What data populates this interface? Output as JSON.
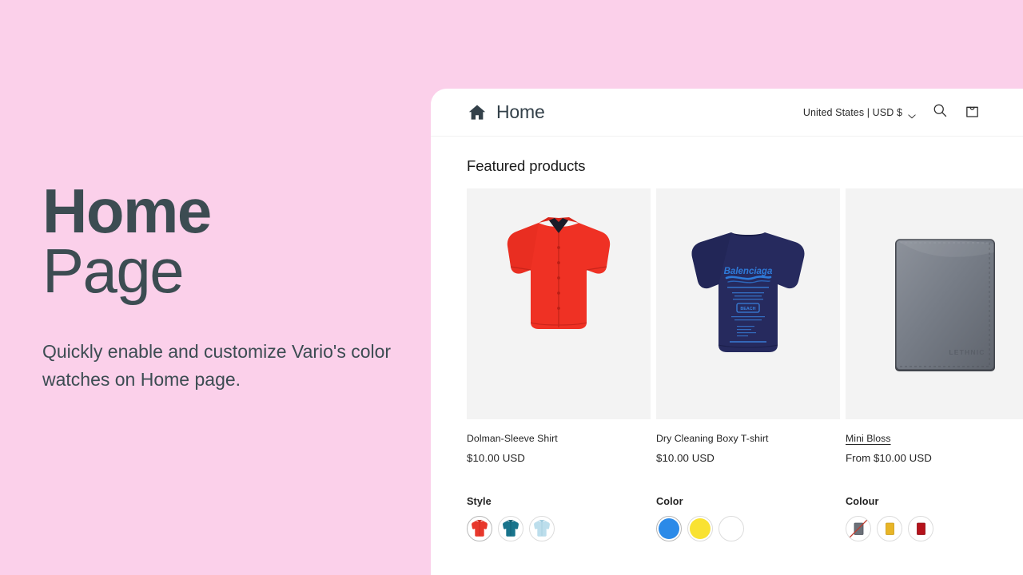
{
  "hero": {
    "title_line1": "Home",
    "title_line2": "Page",
    "subtitle": "Quickly enable and customize Vario's color watches on Home page.",
    "bg_color": "#fbd0ea",
    "text_color": "#3c4c52"
  },
  "header": {
    "home_icon": "home-icon",
    "brand_name": "Home",
    "locale": "United States | USD $",
    "locale_chevron": "chevron-down-icon",
    "search_icon": "search-icon",
    "cart_icon": "cart-icon"
  },
  "main": {
    "section_title": "Featured products",
    "products": [
      {
        "image": "red-dolman-sleeve-shirt",
        "title": "Dolman-Sleeve Shirt",
        "price": "$10.00 USD",
        "is_link": false,
        "option_label": "Style",
        "swatches": [
          {
            "name": "red-shirt-swatch",
            "type": "image",
            "color": "#e8382c",
            "selected": true,
            "unavailable": false
          },
          {
            "name": "teal-shirt-swatch",
            "type": "image",
            "color": "#19748c",
            "selected": false,
            "unavailable": false
          },
          {
            "name": "light-blue-shirt-swatch",
            "type": "image",
            "color": "#bcdeec",
            "selected": false,
            "unavailable": false
          }
        ]
      },
      {
        "image": "navy-dry-cleaning-boxy-tshirt",
        "title": "Dry Cleaning Boxy T-shirt",
        "price": "$10.00 USD",
        "is_link": false,
        "option_label": "Color",
        "swatches": [
          {
            "name": "blue-color-swatch",
            "type": "solid",
            "color": "#2b8ae8",
            "selected": true,
            "unavailable": false
          },
          {
            "name": "yellow-color-swatch",
            "type": "solid",
            "color": "#f9e232",
            "selected": false,
            "unavailable": false
          },
          {
            "name": "white-color-swatch",
            "type": "solid",
            "color": "#ffffff",
            "selected": false,
            "unavailable": false
          }
        ]
      },
      {
        "image": "gray-leather-wallet",
        "title": "Mini Bloss",
        "price": "From $10.00 USD",
        "is_link": true,
        "option_label": "Colour",
        "swatches": [
          {
            "name": "gray-wallet-swatch",
            "type": "image",
            "color": "#6b7078",
            "selected": false,
            "unavailable": true
          },
          {
            "name": "yellow-wallet-swatch",
            "type": "image",
            "color": "#e8b527",
            "selected": false,
            "unavailable": false
          },
          {
            "name": "red-wallet-swatch",
            "type": "image",
            "color": "#b5121b",
            "selected": false,
            "unavailable": false
          }
        ]
      }
    ],
    "tshirt_graphic_text": "Balenciaga",
    "wallet_emboss_text": "LETHNIC"
  }
}
